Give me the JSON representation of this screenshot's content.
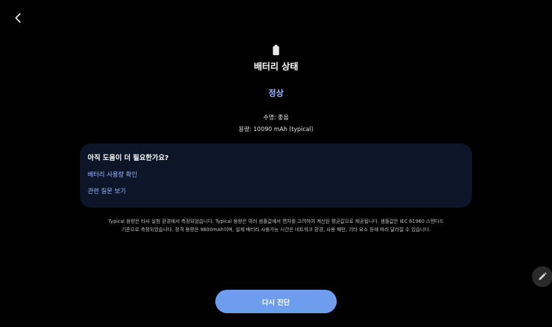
{
  "header": {
    "back_icon": "chevron-left-icon"
  },
  "battery": {
    "icon": "battery-icon",
    "title": "배터리 상태",
    "status": "정상",
    "life": "수명: 좋음",
    "capacity": "용량: 10090 mAh (typical)"
  },
  "help": {
    "title": "아직 도움이 더 필요한가요?",
    "links": [
      {
        "label": "배터리 사용량 확인"
      },
      {
        "label": "관련 질문 보기"
      }
    ]
  },
  "footnote": {
    "line1": "Typical 용량은 타사 실험 환경에서 측정되었습니다. Typical 용량은 여러 샘플값에서 편차를 고려하여 계산된 평균값으로 제공됩니다. 샘플값은 IEC 61960 스탠다드",
    "line2": "기준으로 측정되었습니다. 정격 용량은 9800mAh이며, 실제 배터리 사용가능 시간은 네트워크 환경, 사용 패턴, 기타 요소 등에 따라 달라질 수 있습니다."
  },
  "actions": {
    "edit_icon": "pencil-icon",
    "primary_label": "다시 진단"
  },
  "colors": {
    "background": "#000000",
    "accent": "#9db8ff",
    "card_background": "#0c1628",
    "button": "#6e9dee"
  }
}
